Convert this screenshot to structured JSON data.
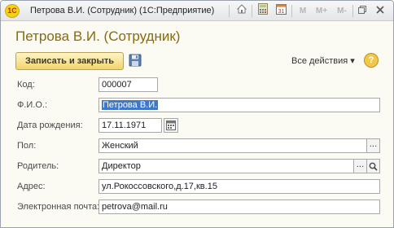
{
  "window": {
    "app_logo": "1С",
    "title": "Петрова В.И. (Сотрудник)  (1С:Предприятие)",
    "toolbar_icons": [
      "home-icon",
      "calculator-icon",
      "calendar-icon"
    ],
    "memory_buttons": [
      "M",
      "M+",
      "M-"
    ]
  },
  "form": {
    "title": "Петрова В.И. (Сотрудник)",
    "save_close_label": "Записать и закрыть",
    "all_actions_label": "Все действия ▾",
    "help_label": "?"
  },
  "fields": {
    "code": {
      "label": "Код:",
      "value": "000007"
    },
    "fio": {
      "label": "Ф.И.О.:",
      "value": "Петрова В.И."
    },
    "birthdate": {
      "label": "Дата рождения:",
      "value": "17.11.1971"
    },
    "gender": {
      "label": "Пол:",
      "value": "Женский",
      "select_label": "..."
    },
    "parent": {
      "label": "Родитель:",
      "value": "Директор",
      "select_label": "..."
    },
    "address": {
      "label": "Адрес:",
      "value": "ул.Рокоссовского,д.17,кв.15"
    },
    "email": {
      "label": "Электронная почта:",
      "value": "petrova@mail.ru"
    }
  },
  "colors": {
    "form_title": "#8a6a0e",
    "save_button": "#f2d46c",
    "selection": "#3f77c9"
  }
}
